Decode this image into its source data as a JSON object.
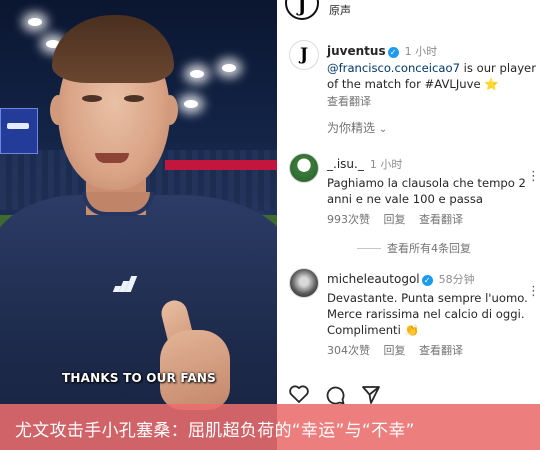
{
  "video": {
    "caption": "THANKS TO OUR FANS"
  },
  "post": {
    "top_label": "原声",
    "author": "juventus",
    "time": "1 小时",
    "mention": "@francisco.conceicao7",
    "caption_rest": " is our player of the match for #AVLJuve",
    "caption_emoji": "⭐",
    "translate": "查看翻译"
  },
  "suggest_label": "为你精选",
  "comments": [
    {
      "user": "_.isu._",
      "time": "1 小时",
      "text": "Paghiamo la clausola che tempo 2 anni e ne vale 100 e passa",
      "likes": "993次赞",
      "reply": "回复",
      "translate": "查看翻译"
    },
    {
      "user": "micheleautogol",
      "time": "58分钟",
      "text": "Devastante. Punta sempre l'uomo. Merce rarissima nel calcio di oggi. Complimenti",
      "emoji": "👏",
      "likes": "304次赞",
      "reply": "回复",
      "translate": "查看翻译"
    }
  ],
  "view_replies": "查看所有4条回复",
  "actions": {
    "like_icon": "heart-icon",
    "comment_icon": "comment-icon",
    "share_icon": "send-icon"
  },
  "banner": {
    "text": "尤文攻击手小孔塞桑：屈肌超负荷的“幸运”与“不幸”"
  },
  "colors": {
    "banner_bg": "#e96c6c",
    "verified": "#1d9bf0",
    "meta_gray": "#737373"
  }
}
